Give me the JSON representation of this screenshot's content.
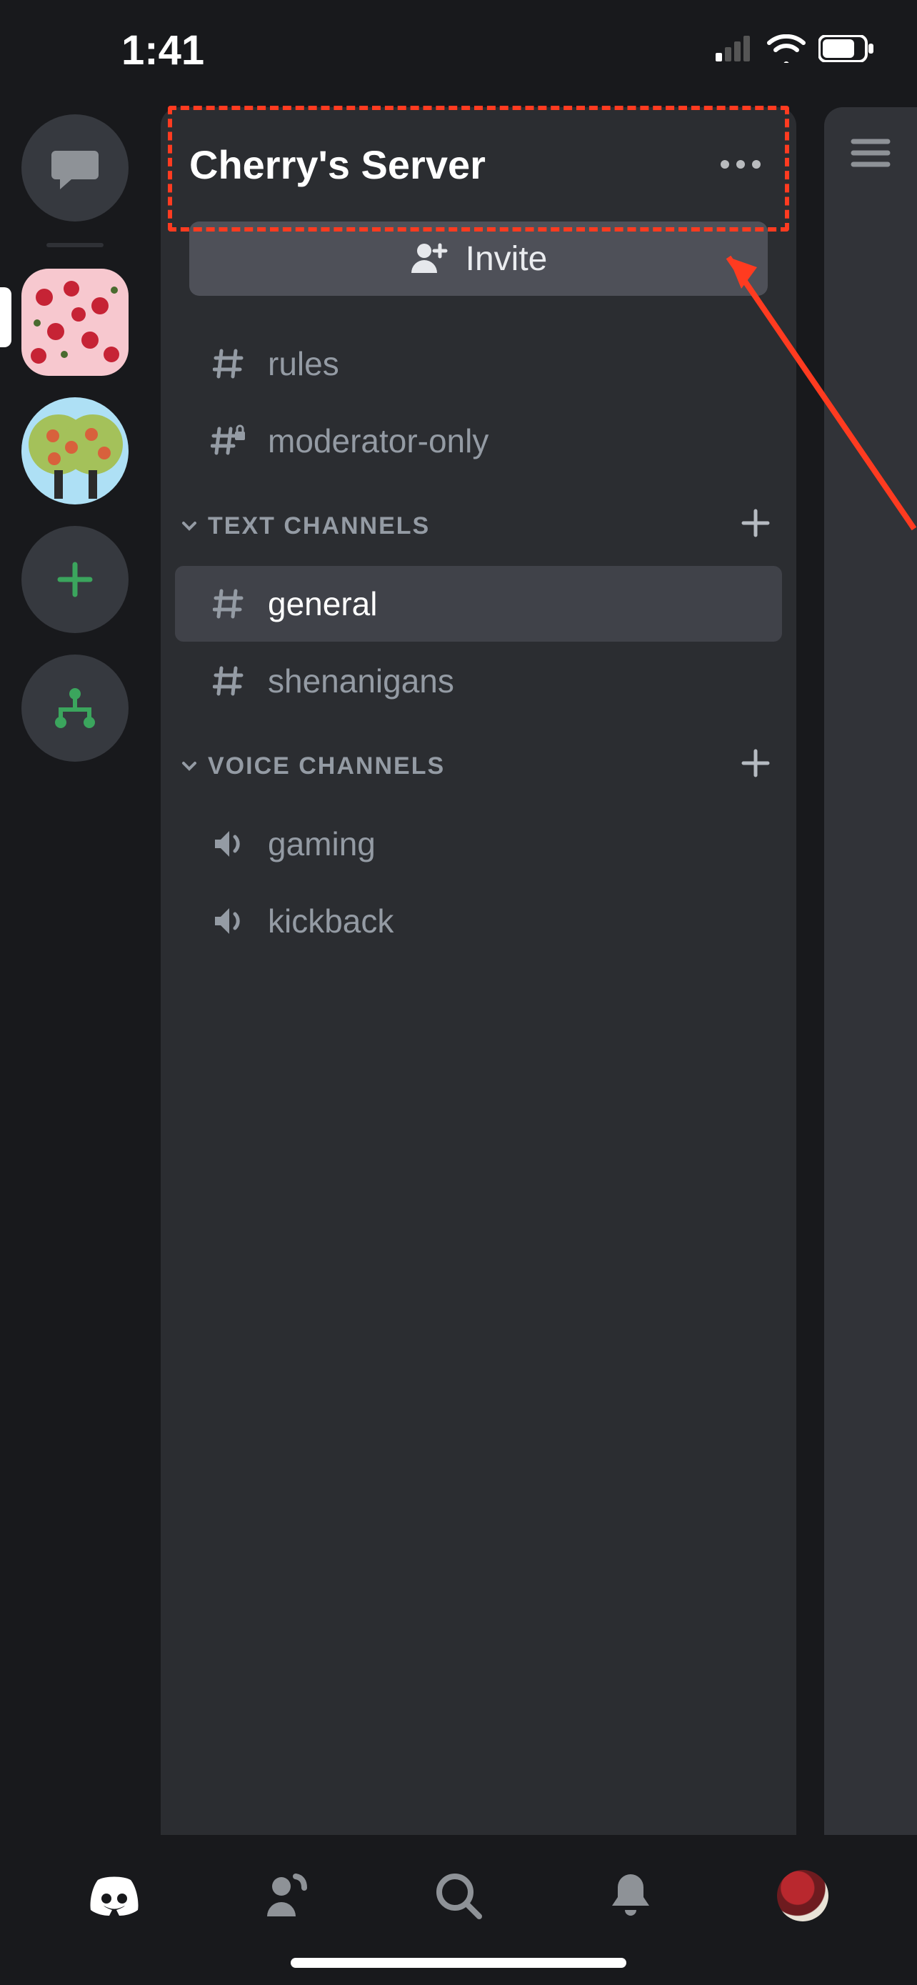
{
  "status": {
    "time": "1:41"
  },
  "server": {
    "title": "Cherry's Server",
    "invite_label": "Invite",
    "top_channels": [
      {
        "name": "rules",
        "icon": "hash"
      },
      {
        "name": "moderator-only",
        "icon": "hash-lock"
      }
    ],
    "categories": [
      {
        "label": "TEXT CHANNELS",
        "channels": [
          {
            "name": "general",
            "icon": "hash",
            "selected": true
          },
          {
            "name": "shenanigans",
            "icon": "hash",
            "selected": false
          }
        ]
      },
      {
        "label": "VOICE CHANNELS",
        "channels": [
          {
            "name": "gaming",
            "icon": "speaker",
            "selected": false
          },
          {
            "name": "kickback",
            "icon": "speaker",
            "selected": false
          }
        ]
      }
    ]
  }
}
